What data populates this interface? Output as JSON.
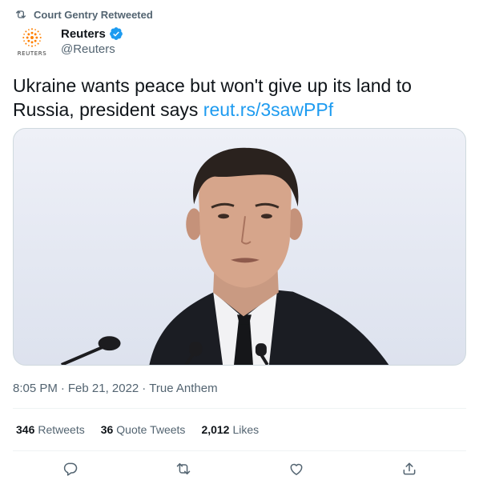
{
  "context": {
    "text": "Court Gentry Retweeted",
    "icon": "retweet-icon"
  },
  "author": {
    "name": "Reuters",
    "handle": "@Reuters",
    "avatar_word": "REUTERS",
    "verified_icon": "verified-badge-icon",
    "brand_color": "#ff8000"
  },
  "tweet": {
    "text": "Ukraine wants peace but won't give up its land to Russia, president says ",
    "link": "reut.rs/3sawPPf",
    "link_color": "#1d9bf0"
  },
  "meta": {
    "time": "8:05 PM",
    "separator": "·",
    "date": "Feb 21, 2022",
    "source": "True Anthem"
  },
  "stats": {
    "retweets_count": "346",
    "retweets_label": "Retweets",
    "quotes_count": "36",
    "quotes_label": "Quote Tweets",
    "likes_count": "2,012",
    "likes_label": "Likes"
  },
  "actions": [
    "reply-icon",
    "retweet-icon",
    "like-icon",
    "share-icon"
  ],
  "colors": {
    "text": "#0f1419",
    "secondary": "#536471",
    "accent": "#1d9bf0",
    "border": "#eff3f4"
  }
}
